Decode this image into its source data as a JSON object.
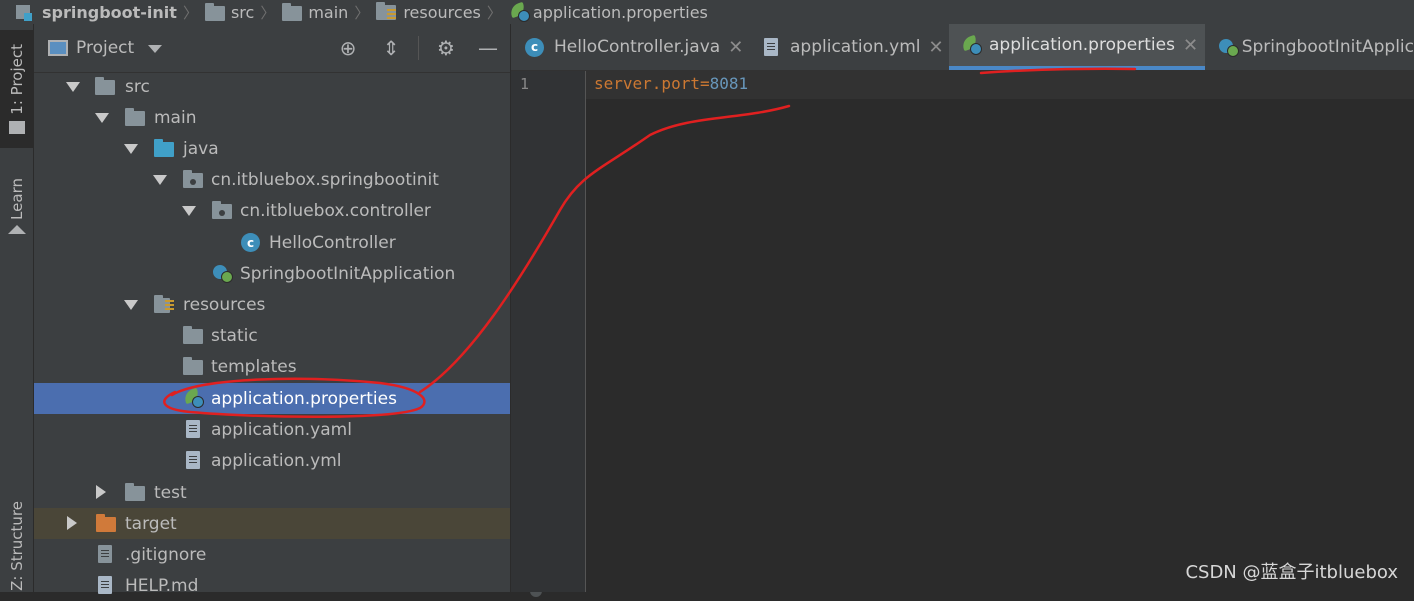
{
  "breadcrumb": {
    "items": [
      {
        "label": "springboot-init",
        "icon": "project-folder-icon"
      },
      {
        "label": "src",
        "icon": "folder-icon"
      },
      {
        "label": "main",
        "icon": "folder-icon"
      },
      {
        "label": "resources",
        "icon": "resources-folder-icon"
      },
      {
        "label": "application.properties",
        "icon": "spring-config-icon"
      }
    ]
  },
  "tool_strip": {
    "tabs": [
      {
        "label": "1: Project",
        "icon": "folder-icon",
        "active": true
      },
      {
        "label": "Learn",
        "icon": "graduation-cap-icon",
        "active": false
      },
      {
        "label": "Z: Structure",
        "icon": "structure-icon",
        "active": false
      }
    ]
  },
  "project_panel": {
    "title": "Project",
    "dropdown_icon": "chevron-down-icon",
    "header_icons": [
      "locate-icon",
      "collapse-all-icon",
      "gear-icon",
      "minimize-icon"
    ],
    "tree": [
      {
        "label": "src",
        "type": "folder",
        "expanded": true
      },
      {
        "label": "main",
        "type": "folder",
        "expanded": true
      },
      {
        "label": "java",
        "type": "source-folder",
        "expanded": true
      },
      {
        "label": "cn.itbluebox.springbootinit",
        "type": "package",
        "expanded": true
      },
      {
        "label": "cn.itbluebox.controller",
        "type": "package",
        "expanded": true
      },
      {
        "label": "HelloController",
        "type": "class"
      },
      {
        "label": "SpringbootInitApplication",
        "type": "spring-class"
      },
      {
        "label": "resources",
        "type": "resources-folder",
        "expanded": true
      },
      {
        "label": "static",
        "type": "folder"
      },
      {
        "label": "templates",
        "type": "folder"
      },
      {
        "label": "application.properties",
        "type": "spring-config",
        "selected": true
      },
      {
        "label": "application.yaml",
        "type": "file"
      },
      {
        "label": "application.yml",
        "type": "file"
      },
      {
        "label": "test",
        "type": "folder",
        "expanded": false
      },
      {
        "label": "target",
        "type": "excluded-folder",
        "expanded": false
      },
      {
        "label": ".gitignore",
        "type": "ignore-file"
      },
      {
        "label": "HELP.md",
        "type": "md-file"
      }
    ]
  },
  "editor": {
    "tabs": [
      {
        "label": "HelloController.java",
        "icon": "class-icon",
        "active": false
      },
      {
        "label": "application.yml",
        "icon": "file-icon",
        "active": false
      },
      {
        "label": "application.properties",
        "icon": "spring-config-icon",
        "active": true
      },
      {
        "label": "SpringbootInitApplic",
        "icon": "spring-class-icon",
        "active": false
      }
    ],
    "line_numbers": [
      "1"
    ],
    "code": {
      "key": "server.port",
      "eq": "=",
      "value": "8081"
    }
  },
  "watermark": "CSDN @蓝盒子itbluebox",
  "colors": {
    "selection": "#4b6eaf",
    "annotation": "#e02020",
    "accent": "#4a88c7",
    "keyword": "#cc7832",
    "number": "#6897bb"
  }
}
